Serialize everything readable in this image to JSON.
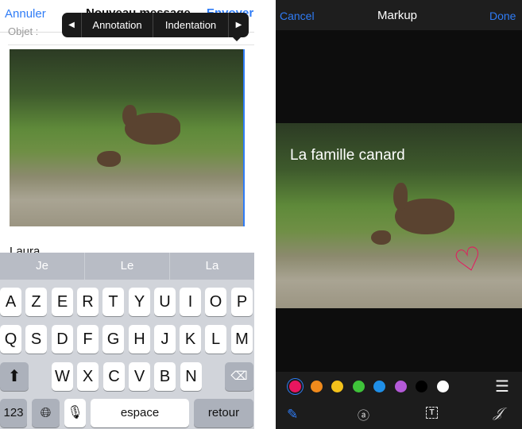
{
  "mail": {
    "cancel": "Annuler",
    "title": "Nouveau message",
    "send": "Envoyer",
    "subject_label": "Objet :",
    "body_text": "Laura"
  },
  "popup": {
    "items": [
      "Annotation",
      "Indentation"
    ]
  },
  "keyboard": {
    "suggestions": [
      "Je",
      "Le",
      "La"
    ],
    "row1": [
      "A",
      "Z",
      "E",
      "R",
      "T",
      "Y",
      "U",
      "I",
      "O",
      "P"
    ],
    "row2": [
      "Q",
      "S",
      "D",
      "F",
      "G",
      "H",
      "J",
      "K",
      "L",
      "M"
    ],
    "row3": [
      "W",
      "X",
      "C",
      "V",
      "B",
      "N"
    ],
    "numbers": "123",
    "space": "espace",
    "return": "retour"
  },
  "markup": {
    "cancel": "Cancel",
    "title": "Markup",
    "done": "Done",
    "caption": "La famille canard",
    "colors": [
      "#e8155f",
      "#f08a1c",
      "#f4c21b",
      "#3fc33a",
      "#1f8fe8",
      "#b45ad8",
      "#000000",
      "#ffffff"
    ],
    "selected_color": "#e8155f",
    "accent": "#2f7cf6"
  }
}
